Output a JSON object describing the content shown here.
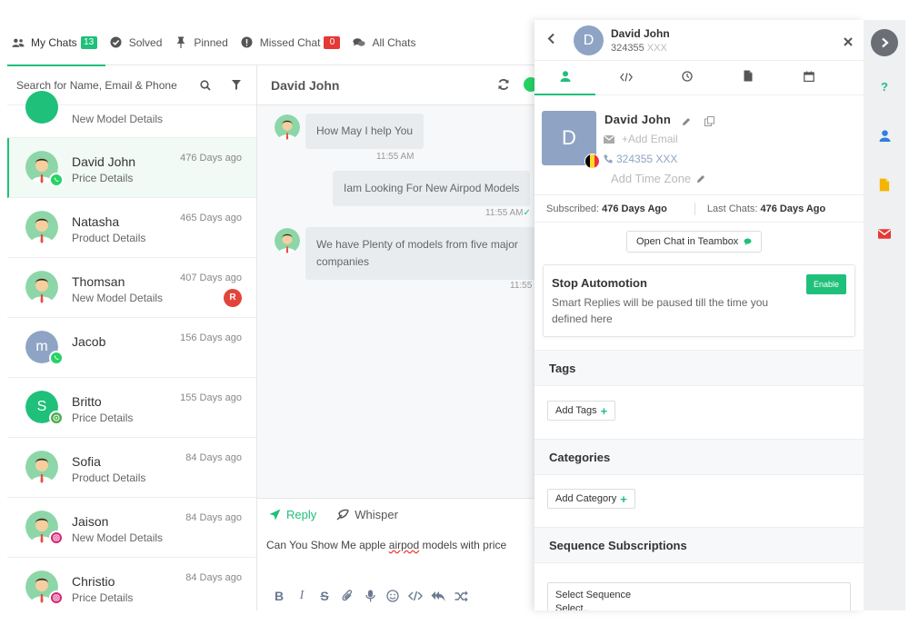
{
  "top_tabs": [
    {
      "label": "My Chats",
      "count": "13"
    },
    {
      "label": "Solved"
    },
    {
      "label": "Pinned"
    },
    {
      "label": "Missed Chat",
      "count": "0"
    },
    {
      "label": "All Chats"
    }
  ],
  "search": {
    "placeholder": "Search for Name, Email & Phone"
  },
  "chats": [
    {
      "name": "",
      "sub": "New Model Details",
      "time": ""
    },
    {
      "name": "David John",
      "sub": "Price Details",
      "time": "476 Days ago",
      "source": "whatsapp"
    },
    {
      "name": "Natasha",
      "sub": "Product Details",
      "time": "465 Days ago"
    },
    {
      "name": "Thomsan",
      "sub": "New Model Details",
      "time": "407 Days ago",
      "badge": "R"
    },
    {
      "name": "Jacob",
      "sub": "",
      "time": "156 Days ago",
      "initial": "m",
      "source": "whatsapp"
    },
    {
      "name": "Britto",
      "sub": "Price Details",
      "time": "155 Days ago",
      "initial": "S",
      "source": "call"
    },
    {
      "name": "Sofia",
      "sub": "Product Details",
      "time": "84 Days ago"
    },
    {
      "name": "Jaison",
      "sub": "New Model Details",
      "time": "84 Days ago",
      "source": "instagram"
    },
    {
      "name": "Christio",
      "sub": "Price Details",
      "time": "84 Days ago",
      "source": "instagram"
    }
  ],
  "conversation": {
    "title": "David John",
    "messages": [
      {
        "from": "agent",
        "text": "How May I help You",
        "time": "11:55 AM"
      },
      {
        "from": "customer",
        "text": "Iam Looking For New Airpod Models",
        "time": "11:55 AM"
      },
      {
        "from": "agent",
        "text": "We have Plenty of models from five major companies",
        "time": "11:55"
      }
    ],
    "composer": {
      "tab_reply": "Reply",
      "tab_whisper": "Whisper",
      "draft_before": "Can You Show Me apple ",
      "draft_typo": "airpod",
      "draft_after": " models with price"
    }
  },
  "profile": {
    "header_name": "David John",
    "header_phone": "324355",
    "header_phone_masked": "XXX",
    "initial": "D",
    "name": "David John",
    "add_email": "+Add Email",
    "phone": "324355 XXX",
    "add_timezone": "Add Time Zone",
    "subscribed_label": "Subscribed:",
    "subscribed_value": "476 Days Ago",
    "last_chats_label": "Last Chats:",
    "last_chats_value": "476 Days Ago",
    "open_chat_label": "Open Chat in Teambox",
    "stop_title": "Stop Automotion",
    "stop_desc": "Smart Replies will be paused till the time you defined here",
    "enable_label": "Enable",
    "tags_heading": "Tags",
    "add_tags": "Add Tags",
    "categories_heading": "Categories",
    "add_category": "Add Category",
    "sequence_heading": "Sequence Subscriptions",
    "select_sequence": "Select Sequence",
    "select_placeholder": "Select.."
  },
  "colors": {
    "accent": "#1fc07a",
    "danger": "#e53935",
    "avatar_blue": "#8fa4c4"
  }
}
